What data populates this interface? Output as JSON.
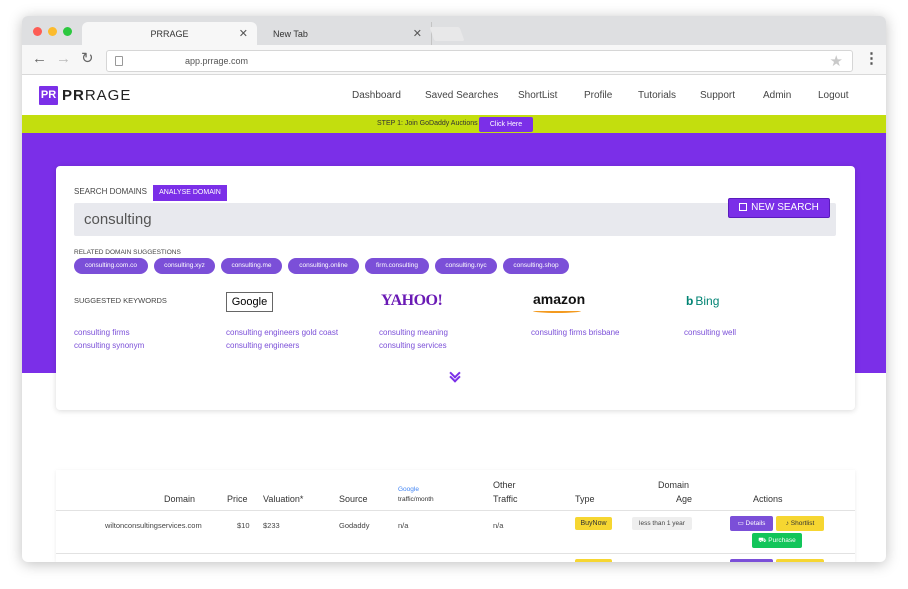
{
  "browser": {
    "tabs": [
      {
        "label": "PRRAGE",
        "close": "✕"
      },
      {
        "label": "New Tab",
        "close": "✕"
      }
    ],
    "url": "app.prrage.com",
    "back": "←",
    "forward": "→",
    "reload": "↻",
    "star": "★",
    "menu": "⋮"
  },
  "site": {
    "logo_box": "PR",
    "logo_bold": "PR",
    "logo_rest": "RAGE",
    "nav": [
      "Dashboard",
      "Saved Searches",
      "ShortList",
      "Profile",
      "Tutorials",
      "Support",
      "Admin",
      "Logout"
    ]
  },
  "banner": {
    "text": "STEP 1: Join GoDaddy Auctions",
    "button": "Click Here"
  },
  "search": {
    "label": "SEARCH DOMAINS",
    "analyse_button": "ANALYSE DOMAIN",
    "value": "consulting",
    "new_search_button": "NEW SEARCH",
    "related_label": "RELATED DOMAIN SUGGESTIONS",
    "related": [
      "consulting.com.co",
      "consulting.xyz",
      "consulting.me",
      "consulting.online",
      "firm.consulting",
      "consulting.nyc",
      "consulting.shop"
    ],
    "keywords_label": "SUGGESTED KEYWORDS",
    "engines": {
      "google": "Google",
      "yahoo": "YAHOO!",
      "amazon": "amazon",
      "bing": "Bing"
    },
    "keyword_columns": [
      [
        "consulting firms",
        "consulting synonym"
      ],
      [
        "consulting engineers gold coast",
        "consulting engineers"
      ],
      [
        "consulting meaning",
        "consulting services"
      ],
      [
        "consulting firms brisbane"
      ],
      [
        "consulting well"
      ]
    ]
  },
  "table": {
    "headers": {
      "domain": "Domain",
      "price": "Price",
      "valuation": "Valuation*",
      "source": "Source",
      "traffic_brand": "Google",
      "traffic": "traffic/month",
      "other_traffic_1": "Other",
      "other_traffic_2": "Traffic",
      "type": "Type",
      "age_1": "Domain",
      "age_2": "Age",
      "actions": "Actions"
    },
    "rows": [
      {
        "domain": "wiltonconsultingservices.com",
        "price": "$10",
        "valuation": "$233",
        "source": "Godaddy",
        "traffic": "n/a",
        "other_traffic": "n/a",
        "type": "BuyNow",
        "age": "less than 1 year",
        "details": "Details",
        "shortlist": "Shortlist",
        "purchase": "Purchase"
      }
    ]
  },
  "colors": {
    "brand_purple": "#7b2fe8",
    "banner_lime": "#c3de0e",
    "buy_yellow": "#f6d631",
    "purchase_green": "#12c55a"
  }
}
